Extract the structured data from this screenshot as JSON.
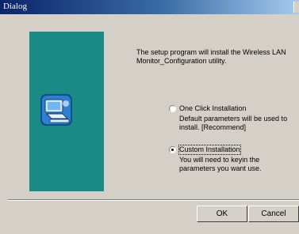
{
  "window": {
    "title": "Dialog"
  },
  "intro_text": "The setup program will install the Wireless LAN Monitor_Configuration utility.",
  "options": [
    {
      "label": "One Click Installation",
      "description": "Default parameters will be used to install. [Recommend]",
      "selected": false
    },
    {
      "label": "Custom Installation",
      "description": "You will need to keyin the parameters you want use.",
      "selected": true
    }
  ],
  "buttons": {
    "ok_label": "OK",
    "cancel_label": "Cancel"
  },
  "colors": {
    "panel": "#1a8a84",
    "titlebar_start": "#0a246a",
    "titlebar_end": "#a6caf0"
  },
  "icons": {
    "setup": "computer-install-icon"
  }
}
